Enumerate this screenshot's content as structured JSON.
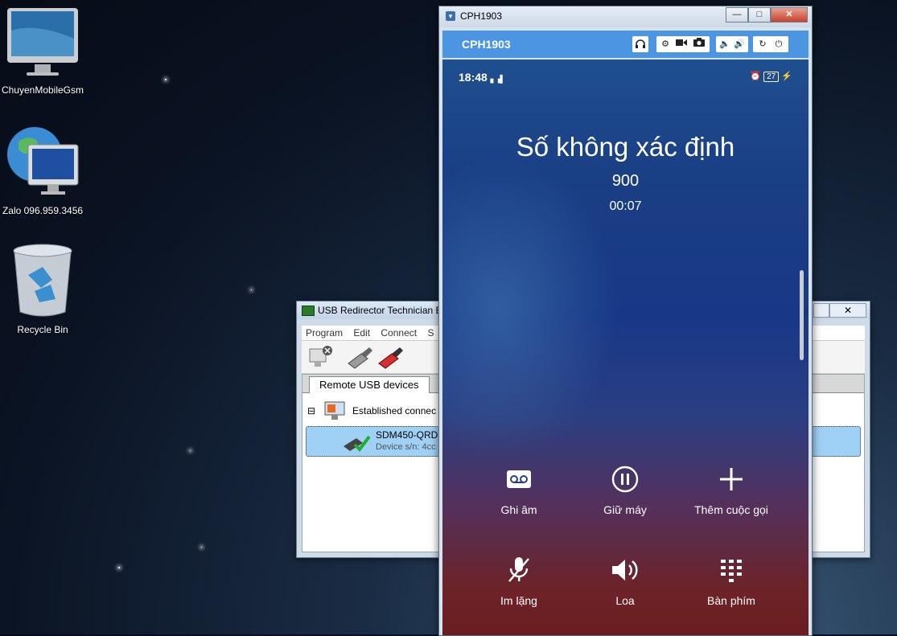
{
  "desktop": {
    "icons": [
      {
        "label": "ChuyenMobileGsm",
        "icon": "imac-icon"
      },
      {
        "label": "Zalo 096.959.3456",
        "icon": "globe-monitor-icon"
      },
      {
        "label": "Recycle Bin",
        "icon": "recycle-bin-icon"
      }
    ]
  },
  "usb_window": {
    "title": "USB Redirector Technician E",
    "close_glyph": "✕",
    "menu": [
      "Program",
      "Edit",
      "Connect",
      "S"
    ],
    "tab_label": "Remote USB devices",
    "tree_group": "Established connec",
    "device_name": "SDM450-QRD",
    "device_sub": "Device s/n: 4cc"
  },
  "phone_window": {
    "title": "CPH1903",
    "bar_name": "CPH1903",
    "controls": [
      "headset-icon",
      "gear-icon",
      "video-icon",
      "camera-icon",
      "volume-down-icon",
      "volume-up-icon",
      "rotate-icon",
      "power-icon"
    ],
    "status": {
      "time": "18:48",
      "battery": "27"
    },
    "call": {
      "caller": "Số không xác định",
      "number": "900",
      "duration": "00:07"
    },
    "actions": [
      {
        "label": "Ghi âm",
        "icon": "record-icon"
      },
      {
        "label": "Giữ máy",
        "icon": "pause-icon"
      },
      {
        "label": "Thêm cuộc gọi",
        "icon": "plus-icon"
      },
      {
        "label": "Im lặng",
        "icon": "mute-mic-icon"
      },
      {
        "label": "Loa",
        "icon": "speaker-icon"
      },
      {
        "label": "Bàn phím",
        "icon": "keypad-icon"
      }
    ]
  },
  "colors": {
    "phone_bar": "#4c95e0",
    "device_highlight": "#9fd0f5"
  }
}
